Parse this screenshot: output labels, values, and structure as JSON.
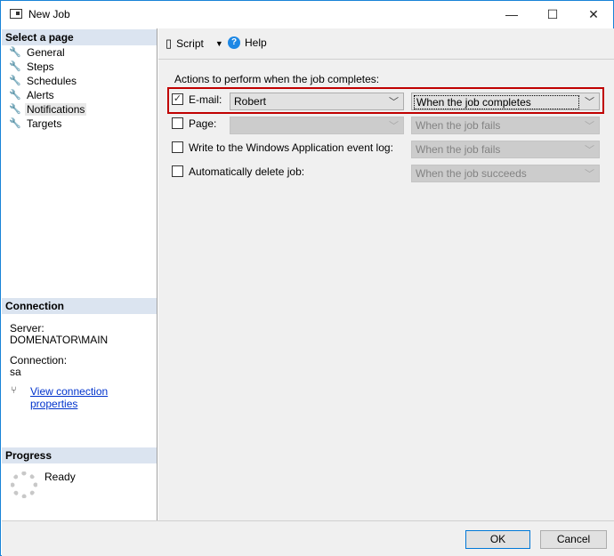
{
  "window": {
    "title": "New Job",
    "minimize": "—",
    "maximize": "☐",
    "close": "✕"
  },
  "sidebar": {
    "select_header": "Select a page",
    "items": [
      {
        "label": "General"
      },
      {
        "label": "Steps"
      },
      {
        "label": "Schedules"
      },
      {
        "label": "Alerts"
      },
      {
        "label": "Notifications",
        "selected": true
      },
      {
        "label": "Targets"
      }
    ],
    "connection_header": "Connection",
    "server_label": "Server:",
    "server_value": "DOMENATOR\\MAIN",
    "connection_label": "Connection:",
    "connection_value": "sa",
    "view_link": "View connection properties",
    "progress_header": "Progress",
    "progress_status": "Ready"
  },
  "toolbar": {
    "script": "Script",
    "help": "Help"
  },
  "main": {
    "heading": "Actions to perform when the job completes:",
    "rows": [
      {
        "label": "E-mail:",
        "checked": true,
        "operator": "Robert",
        "condition": "When the job completes",
        "enabled": true
      },
      {
        "label": "Page:",
        "checked": false,
        "operator": "",
        "condition": "When the job fails",
        "enabled": false
      },
      {
        "label": "Write to the Windows Application event log:",
        "checked": false,
        "condition": "When the job fails",
        "enabled": false
      },
      {
        "label": "Automatically delete job:",
        "checked": false,
        "condition": "When the job succeeds",
        "enabled": false
      }
    ],
    "highlight_color": "#c00000"
  },
  "footer": {
    "ok": "OK",
    "cancel": "Cancel"
  }
}
